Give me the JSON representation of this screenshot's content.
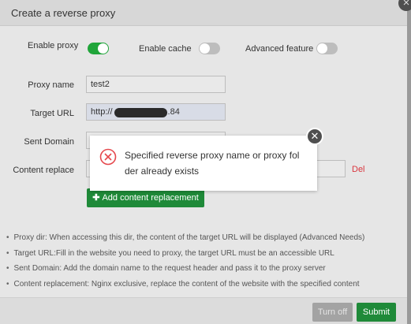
{
  "dialog": {
    "title": "Create a reverse proxy",
    "close_icon": "close-icon"
  },
  "toggles": [
    {
      "label": "Enable proxy",
      "on": true
    },
    {
      "label": "Enable cache",
      "on": false
    },
    {
      "label": "Advanced feature",
      "on": false
    }
  ],
  "form": {
    "proxy_name_label": "Proxy name",
    "proxy_name_value": "test2",
    "target_url_label": "Target URL",
    "target_url_prefix": "http://",
    "target_url_suffix": ".84",
    "sent_domain_label": "Sent Domain",
    "content_replace_label": "Content replace",
    "delete_label": "Del",
    "add_button_label": "Add content replacement",
    "add_icon": "plus-icon"
  },
  "notes": [
    "Proxy dir: When accessing this dir, the content of the target URL will be displayed (Advanced Needs)",
    "Target URL:Fill in the website you need to proxy, the target URL must be an accessible URL",
    "Sent Domain: Add the domain name to the request header and pass it to the proxy server",
    "Content replacement: Nginx exclusive, replace the content of the website with the specified content"
  ],
  "footer": {
    "turn_off_label": "Turn off",
    "submit_label": "Submit"
  },
  "error_popup": {
    "icon": "error-circle-icon",
    "message_line1": "Specified reverse proxy name or proxy fol",
    "message_line2": "der already exists",
    "close_icon": "close-icon"
  },
  "colors": {
    "accent_green": "#20a53a",
    "button_green": "#1f8a39",
    "error_red": "#e5484d",
    "delete_red": "#d9363e"
  }
}
